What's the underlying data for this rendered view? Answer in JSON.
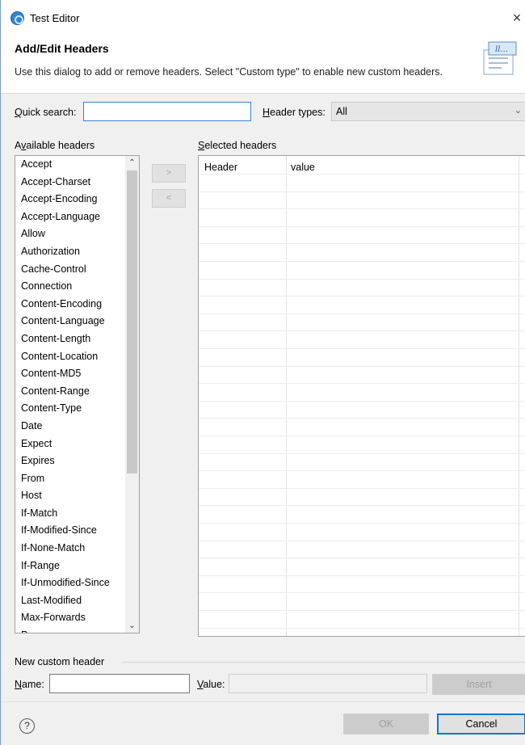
{
  "window": {
    "title": "Test Editor",
    "close_glyph": "×"
  },
  "header": {
    "title": "Add/Edit Headers",
    "description": "Use this dialog to add or remove headers. Select \"Custom type\" to enable new custom headers.",
    "banner_icon": "dialog-banner-icon"
  },
  "search": {
    "quick_search_label_u": "Q",
    "quick_search_label_rest": "uick search:",
    "quick_search_value": "",
    "header_types_label_u": "H",
    "header_types_label_rest": "eader types:",
    "header_types_value": "All"
  },
  "available": {
    "label_pre": "A",
    "label_u": "v",
    "label_rest": "ailable headers",
    "items": [
      "Accept",
      "Accept-Charset",
      "Accept-Encoding",
      "Accept-Language",
      "Allow",
      "Authorization",
      "Cache-Control",
      "Connection",
      "Content-Encoding",
      "Content-Language",
      "Content-Length",
      "Content-Location",
      "Content-MD5",
      "Content-Range",
      "Content-Type",
      "Date",
      "Expect",
      "Expires",
      "From",
      "Host",
      "If-Match",
      "If-Modified-Since",
      "If-None-Match",
      "If-Range",
      "If-Unmodified-Since",
      "Last-Modified",
      "Max-Forwards",
      "Pragma"
    ]
  },
  "move": {
    "add_label": ">",
    "remove_label": "<"
  },
  "selected": {
    "label_u": "S",
    "label_rest": "elected headers",
    "columns": [
      "Header",
      "value"
    ]
  },
  "custom": {
    "group_label": "New custom header",
    "name_label_u": "N",
    "name_label_rest": "ame:",
    "name_value": "",
    "value_label_u": "V",
    "value_label_rest": "alue:",
    "value_value": "",
    "insert_label": "Insert"
  },
  "footer": {
    "help_glyph": "?",
    "ok_label": "OK",
    "cancel_label": "Cancel"
  }
}
